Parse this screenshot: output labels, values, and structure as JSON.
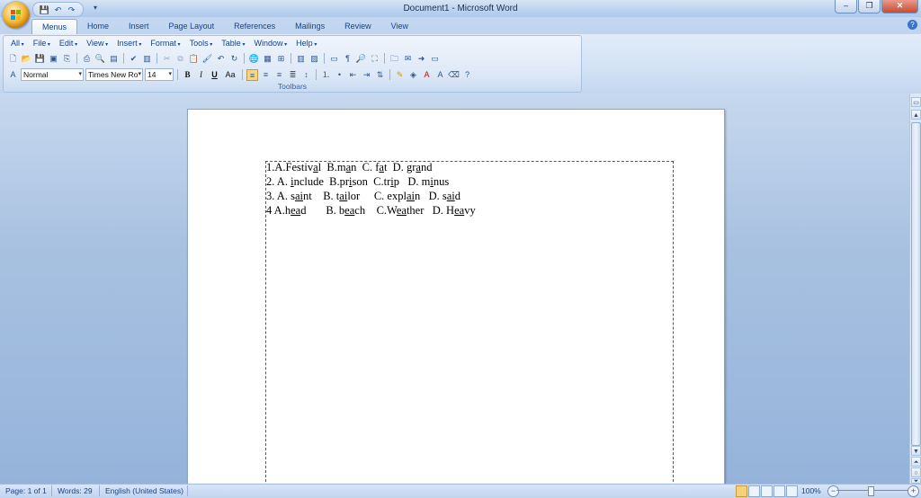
{
  "window": {
    "title": "Document1 - Microsoft Word",
    "minimize": "–",
    "restore": "❐",
    "close": "✕"
  },
  "qat": {
    "save": "💾",
    "undo": "↶",
    "redo": "↷",
    "more": "▾"
  },
  "tabs": [
    "Menus",
    "Home",
    "Insert",
    "Page Layout",
    "References",
    "Mailings",
    "Review",
    "View"
  ],
  "menus": [
    "All",
    "File",
    "Edit",
    "View",
    "Insert",
    "Format",
    "Tools",
    "Table",
    "Window",
    "Help"
  ],
  "toolbar": {
    "style_value": "Normal",
    "font_value": "Times New Ro",
    "size_value": "14",
    "bold": "B",
    "italic": "I",
    "underline": "U",
    "change_case": "Aa",
    "group_label": "Toolbars"
  },
  "document": {
    "lines": [
      [
        {
          "t": "1.A.Festiv"
        },
        {
          "t": "a",
          "u": true
        },
        {
          "t": "l  B.m"
        },
        {
          "t": "a",
          "u": true
        },
        {
          "t": "n  C. f"
        },
        {
          "t": "a",
          "u": true
        },
        {
          "t": "t  D. gr"
        },
        {
          "t": "a",
          "u": true
        },
        {
          "t": "nd"
        }
      ],
      [
        {
          "t": "2. A. "
        },
        {
          "t": "i",
          "u": true
        },
        {
          "t": "nclude  B.pr"
        },
        {
          "t": "i",
          "u": true
        },
        {
          "t": "son  C.tr"
        },
        {
          "t": "i",
          "u": true
        },
        {
          "t": "p   D. m"
        },
        {
          "t": "i",
          "u": true
        },
        {
          "t": "nus"
        }
      ],
      [
        {
          "t": "3. A. s"
        },
        {
          "t": "ai",
          "u": true
        },
        {
          "t": "nt    B. t"
        },
        {
          "t": "ai",
          "u": true
        },
        {
          "t": "lor     C. expl"
        },
        {
          "t": "ai",
          "u": true
        },
        {
          "t": "n   D. s"
        },
        {
          "t": "ai",
          "u": true
        },
        {
          "t": "d"
        }
      ],
      [
        {
          "t": "4 A.h"
        },
        {
          "t": "ea",
          "u": true
        },
        {
          "t": "d       B. b"
        },
        {
          "t": "ea",
          "u": true
        },
        {
          "t": "ch    C.W"
        },
        {
          "t": "ea",
          "u": true
        },
        {
          "t": "ther   D. H"
        },
        {
          "t": "ea",
          "u": true
        },
        {
          "t": "vy"
        }
      ]
    ]
  },
  "status": {
    "page": "Page: 1 of 1",
    "words": "Words: 29",
    "language": "English (United States)",
    "zoom": "100%",
    "zoom_minus": "−",
    "zoom_plus": "+"
  }
}
